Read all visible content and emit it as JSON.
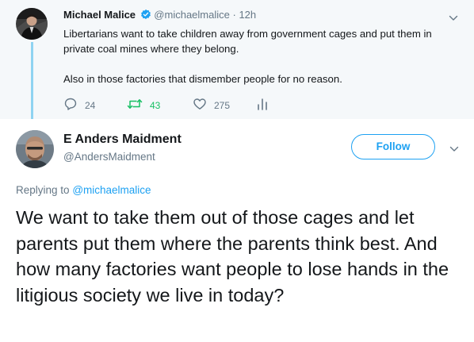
{
  "parent_tweet": {
    "author_name": "Michael Malice",
    "handle": "@michaelmalice",
    "separator": "·",
    "time": "12h",
    "paragraphs": [
      "Libertarians want to take children away from government cages and put them in private coal mines where they belong.",
      "Also in those factories that dismember people for no reason."
    ],
    "replies_count": "24",
    "retweets_count": "43",
    "likes_count": "275",
    "icons": {
      "verified": "verified-badge-icon",
      "more": "chevron-down-icon",
      "reply": "reply-icon",
      "retweet": "retweet-icon",
      "like": "heart-icon",
      "analytics": "analytics-icon"
    }
  },
  "reply_tweet": {
    "author_name": "E Anders Maidment",
    "handle": "@AndersMaidment",
    "follow_label": "Follow",
    "replying_prefix": "Replying to",
    "replying_to": "@michaelmalice",
    "text": "We want to take them out of those cages and let parents put them where the parents think best. And how many factories want people to lose hands in the litigious society we live in today?",
    "icons": {
      "more": "chevron-down-icon"
    }
  },
  "colors": {
    "accent": "#1da1f2",
    "retweet_green": "#17bf63",
    "secondary_text": "#657786",
    "thread_line": "#8fd3f1",
    "parent_background": "#f5f8fa"
  }
}
